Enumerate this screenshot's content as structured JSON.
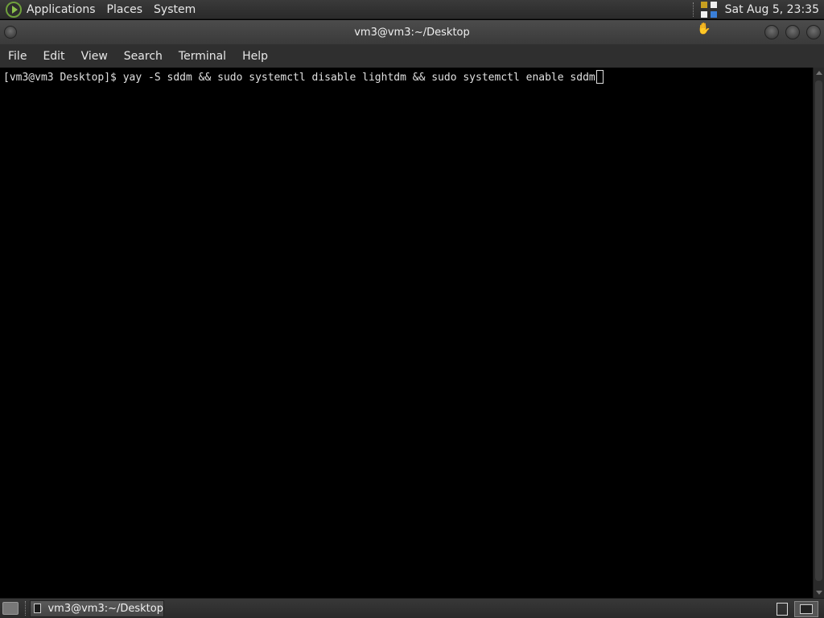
{
  "top_panel": {
    "menus": [
      "Applications",
      "Places",
      "System"
    ],
    "clock": "Sat Aug  5, 23:35",
    "icons": {
      "logo": "mint-logo-icon",
      "tray": "keyboard-layout-icon"
    }
  },
  "window": {
    "title": "vm3@vm3:~/Desktop",
    "menus": [
      "File",
      "Edit",
      "View",
      "Search",
      "Terminal",
      "Help"
    ]
  },
  "terminal": {
    "prompt": "[vm3@vm3 Desktop]$ ",
    "command": "yay -S sddm && sudo systemctl disable lightdm && sudo systemctl enable sddm"
  },
  "bottom_panel": {
    "task_label": "vm3@vm3:~/Desktop"
  },
  "colors": {
    "background": "#000000",
    "panel": "#2f2f2f",
    "text": "#e0e0e0",
    "accent": "#6fa03c"
  }
}
